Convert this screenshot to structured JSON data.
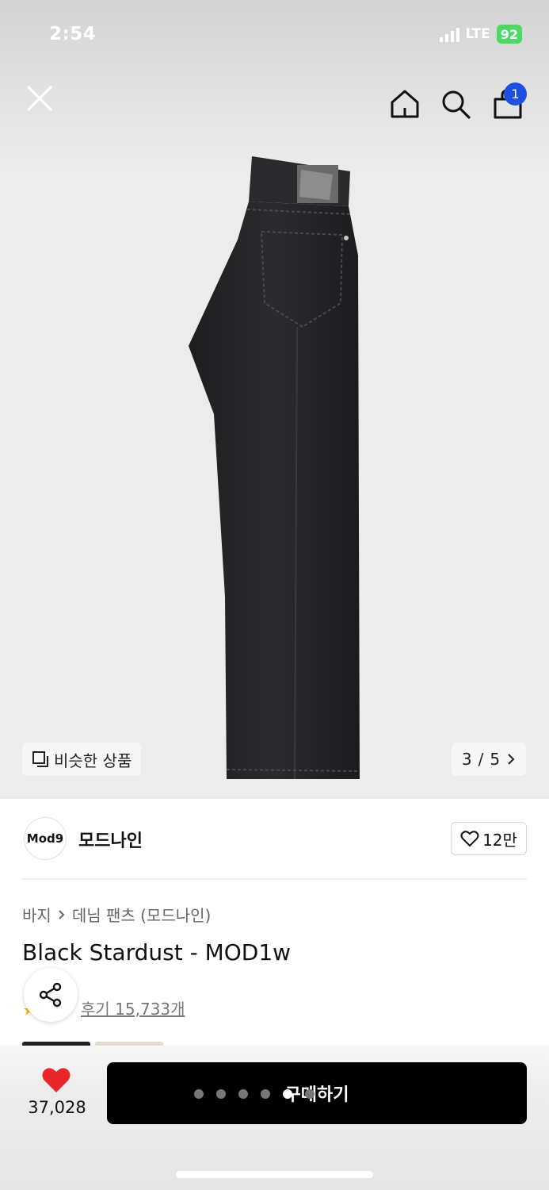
{
  "status_bar": {
    "time": "2:54",
    "network": "LTE",
    "battery": "92"
  },
  "header": {
    "cart_count": "1"
  },
  "icons": {
    "close": "close-icon",
    "home": "home-icon",
    "search": "search-icon",
    "bag": "shopping-bag-icon",
    "similar": "copy-icon",
    "chevron": "chevron-right-icon",
    "heart_outline": "heart-outline-icon",
    "heart_filled": "heart-filled-icon",
    "share": "share-icon"
  },
  "gallery": {
    "similar_label": "비슷한 상품",
    "current_page": "3",
    "total_pages": "5"
  },
  "brand": {
    "logo_text": "Mod9",
    "name": "모드나인",
    "like_count": "12만"
  },
  "product": {
    "breadcrumb": [
      "바지",
      "데님 팬츠 (모드나인)"
    ],
    "title": "Black Stardust - MOD1w",
    "review_label": "후기 15,733개"
  },
  "bottom_bar": {
    "like_count": "37,028",
    "buy_label": "구매하기"
  },
  "colors": {
    "accent_red": "#e8262b",
    "badge_blue": "#1f4fe0",
    "buy_button": "#000000",
    "battery_green": "#4cd964"
  }
}
